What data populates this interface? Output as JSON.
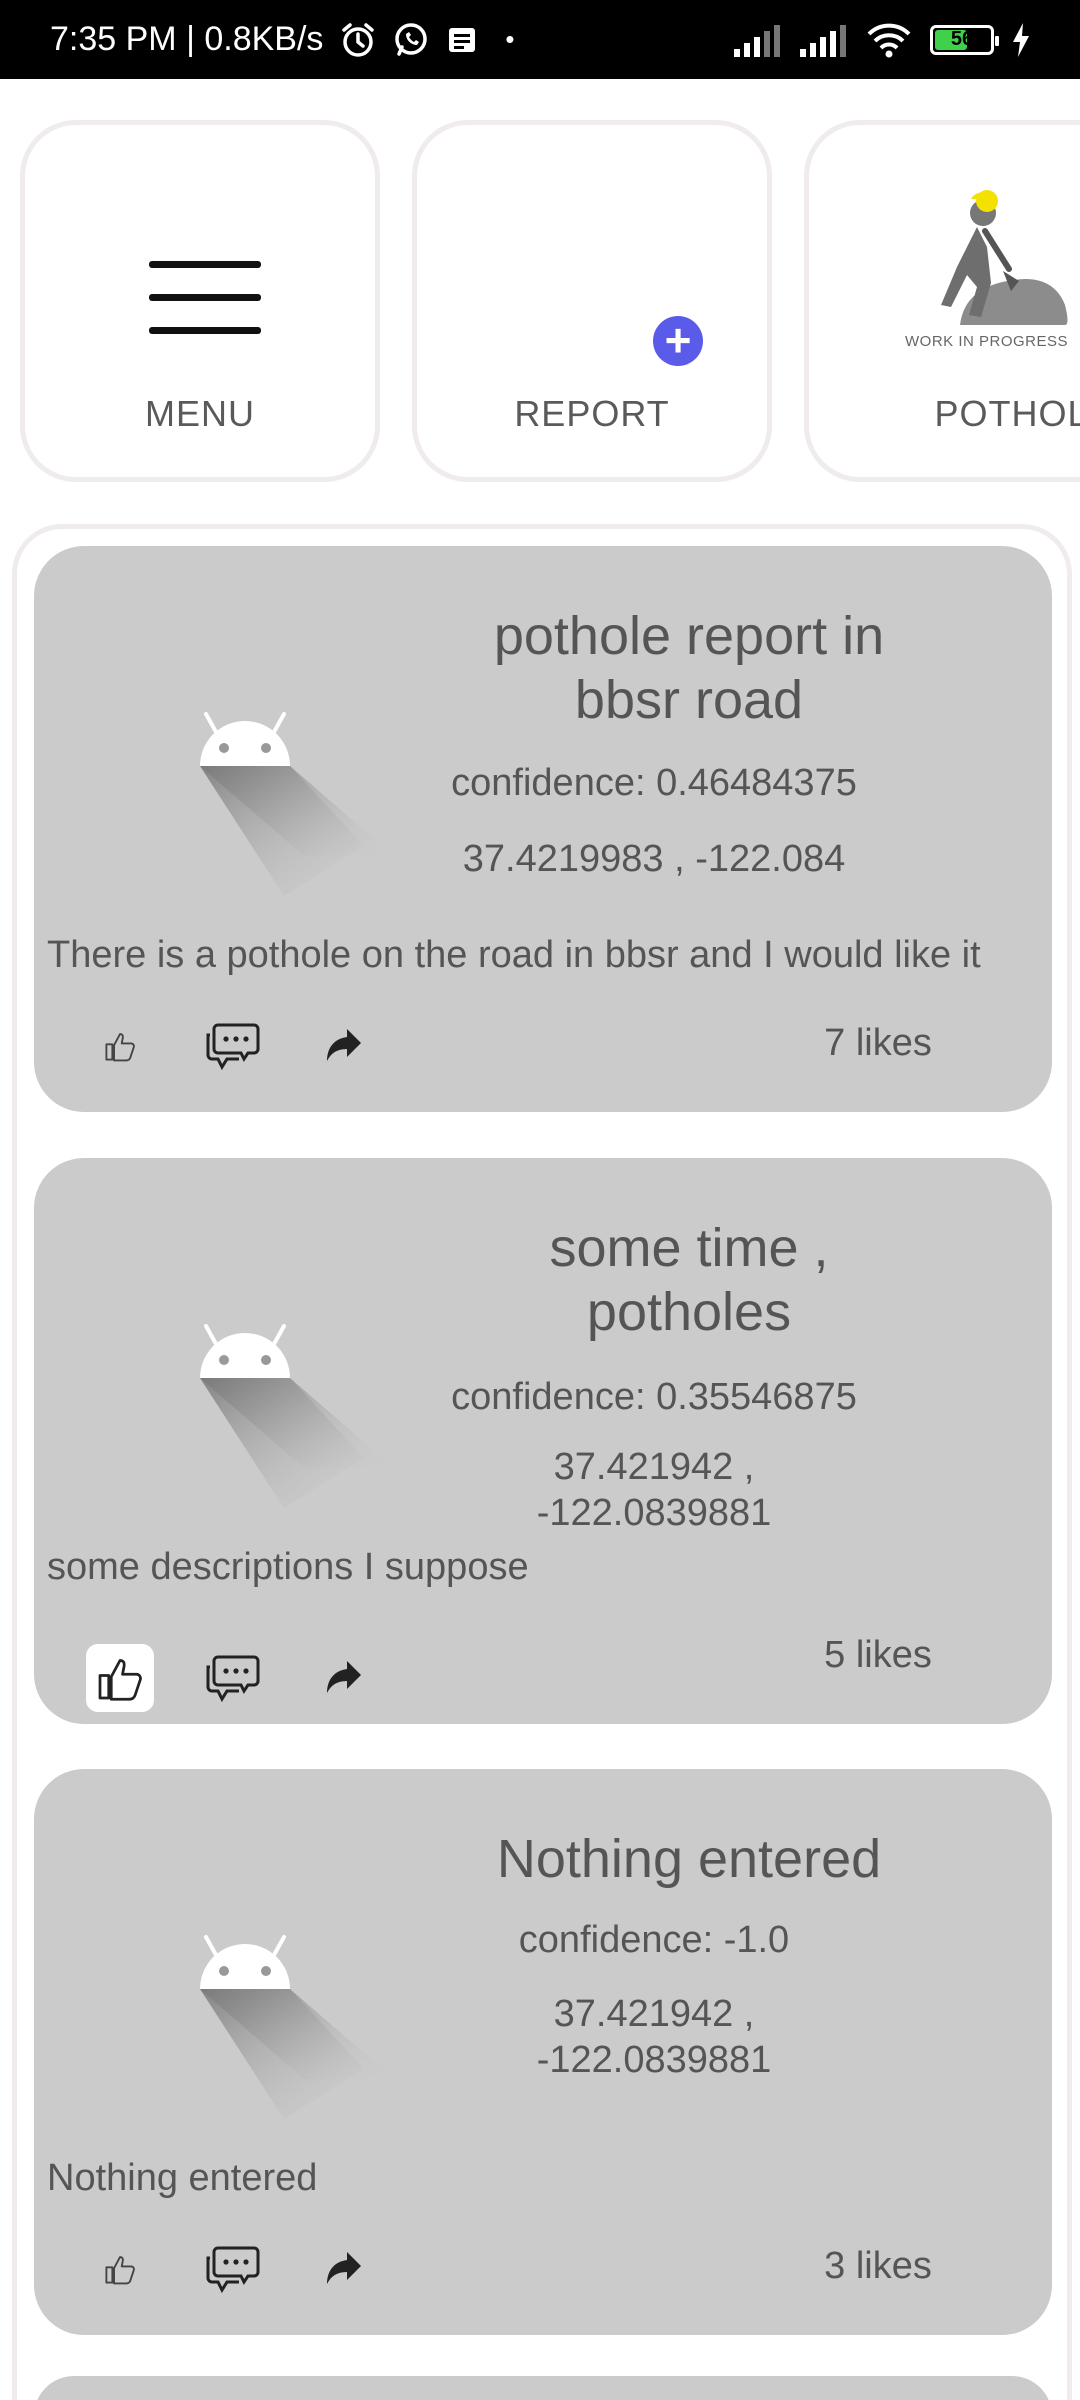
{
  "status_bar": {
    "time_speed": "7:35 PM | 0.8KB/s",
    "dot": "•",
    "battery": "56",
    "icons": [
      "alarm-icon",
      "whatsapp-icon",
      "message-icon",
      "signal-icon",
      "signal-icon",
      "wifi-icon",
      "battery-icon",
      "charging-icon"
    ]
  },
  "tiles": {
    "menu": {
      "label": "MENU",
      "icon": "hamburger-icon"
    },
    "report": {
      "label": "REPORT",
      "icon": "plus-icon"
    },
    "pothole": {
      "label": "POTHOLE",
      "image_text": "WORK IN PROGRESS",
      "icon": "work-in-progress-icon"
    }
  },
  "colors": {
    "card_bg": "#cbcbcb",
    "accent_plus": "#5b5bea",
    "tile_border": "#f0ecee",
    "battery_green": "#3fd14a"
  },
  "posts": [
    {
      "title_line1": "pothole report in",
      "title_line2": "bbsr road",
      "confidence": "confidence: 0.46484375",
      "coords_line1": "37.4219983 , -122.084",
      "coords_line2": "",
      "description": "There is a pothole on the road in bbsr and I would like it",
      "likes": "7 likes",
      "liked": false
    },
    {
      "title_line1": "some time ,",
      "title_line2": "potholes",
      "confidence": "confidence: 0.35546875",
      "coords_line1": "37.421942 ,",
      "coords_line2": "-122.0839881",
      "description": "some descriptions I suppose",
      "likes": "5 likes",
      "liked": true
    },
    {
      "title_line1": "Nothing entered",
      "title_line2": "",
      "confidence": "confidence: -1.0",
      "coords_line1": "37.421942 ,",
      "coords_line2": "-122.0839881",
      "description": "Nothing entered",
      "likes": "3 likes",
      "liked": false
    }
  ]
}
